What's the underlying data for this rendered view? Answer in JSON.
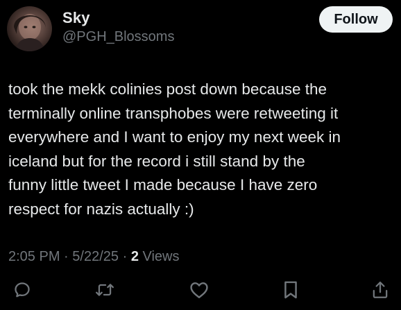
{
  "author": {
    "display_name": "Sky",
    "handle": "@PGH_Blossoms",
    "follow_label": "Follow"
  },
  "tweet": {
    "lines": [
      "took the mekk colinies post down because the",
      "terminally online transphobes were retweeting it",
      "everywhere and I want to enjoy my next week in",
      "iceland but for the record i still stand by the",
      "funny little tweet I made because I have zero",
      "respect for nazis actually :)"
    ]
  },
  "meta": {
    "time": "2:05 PM",
    "separator": "·",
    "date": "5/22/25",
    "views_count": "2",
    "views_label": "Views"
  },
  "actions": [
    {
      "name": "reply-icon"
    },
    {
      "name": "retweet-icon"
    },
    {
      "name": "like-icon"
    },
    {
      "name": "bookmark-icon"
    },
    {
      "name": "share-icon"
    }
  ],
  "colors": {
    "background": "#000000",
    "text_primary": "#e7e9ea",
    "text_secondary": "#71767b",
    "follow_button_bg": "#eff3f4",
    "follow_button_text": "#0f1419"
  }
}
